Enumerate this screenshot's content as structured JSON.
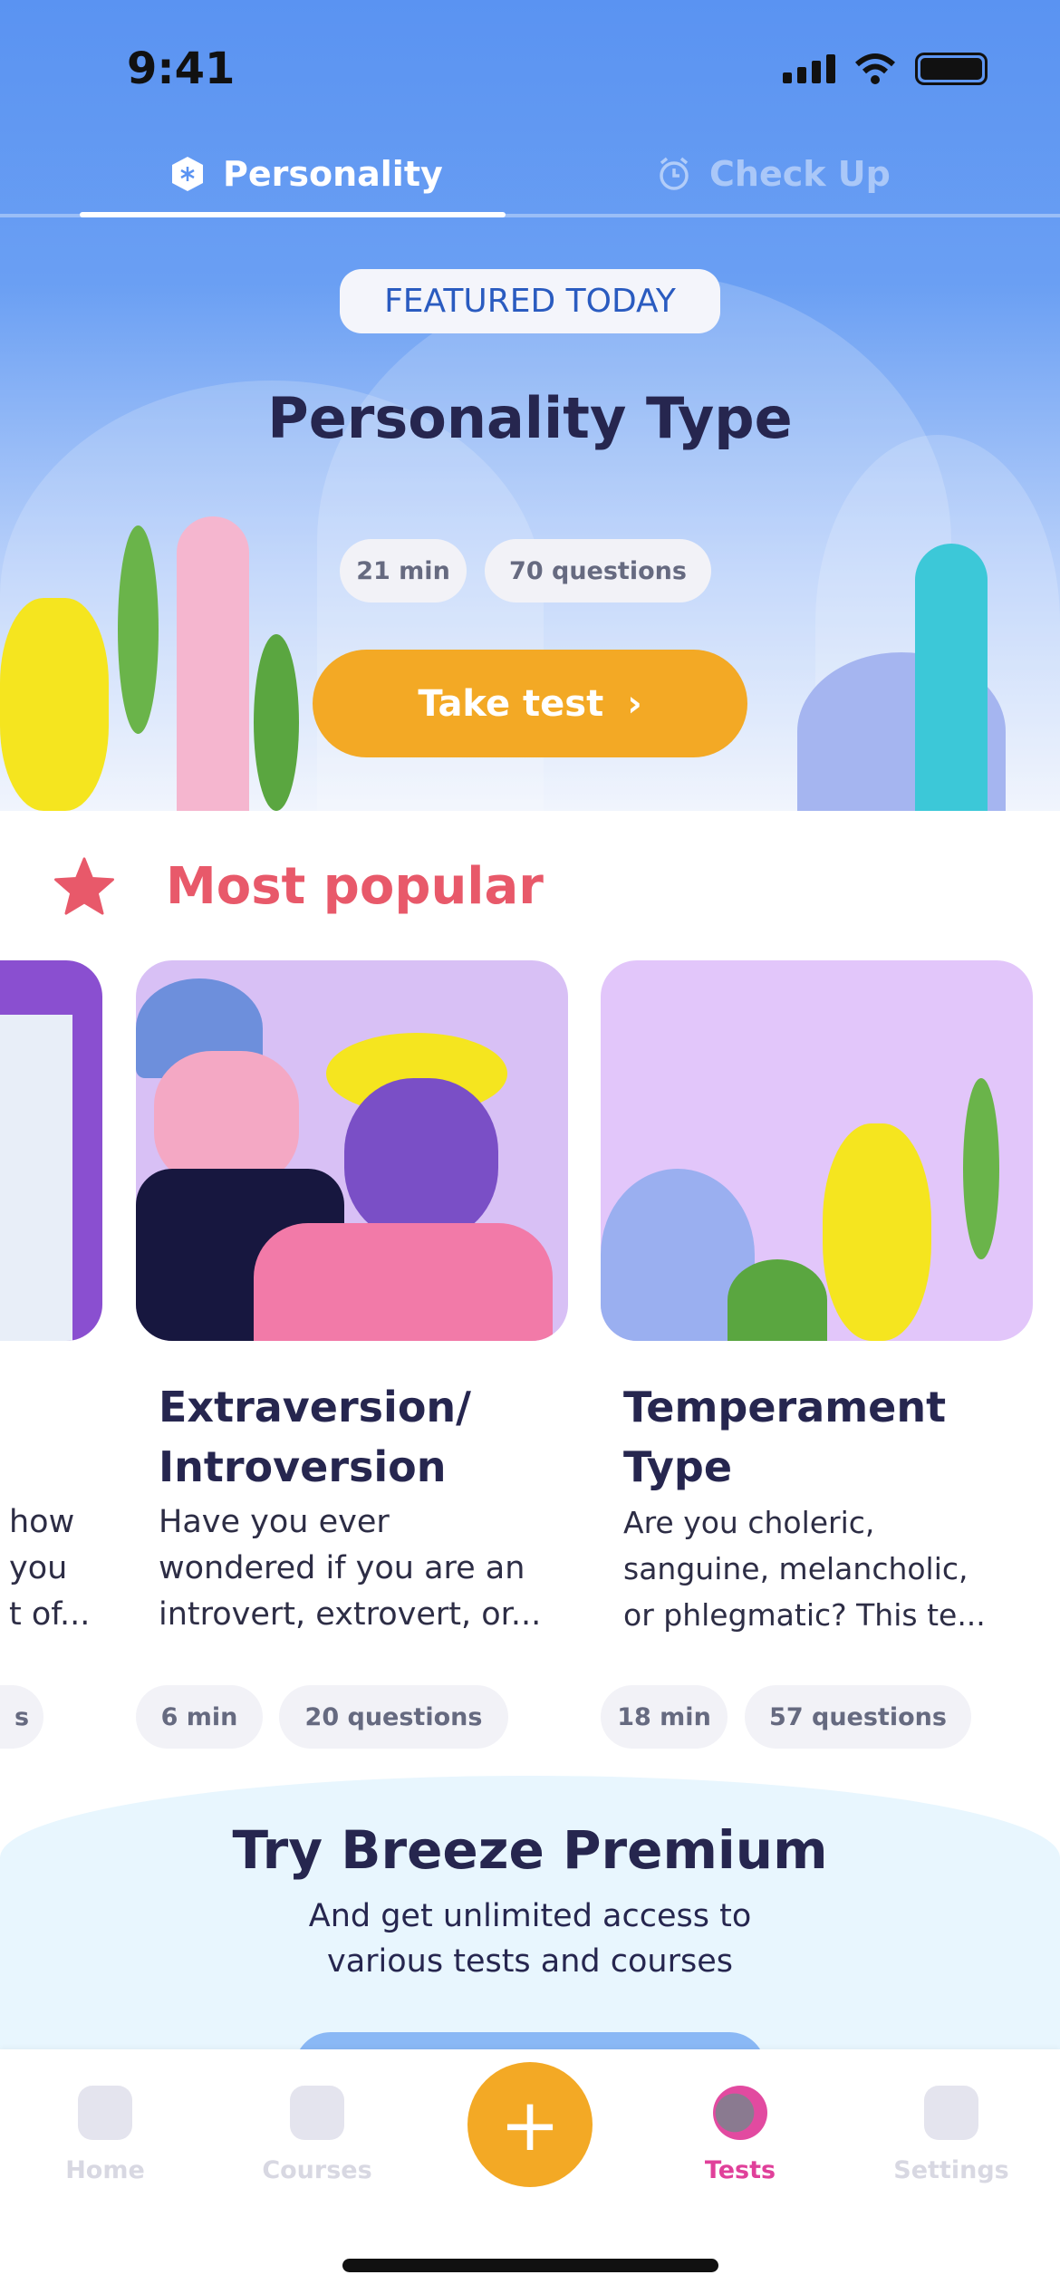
{
  "status": {
    "time": "9:41"
  },
  "top_tabs": [
    {
      "label": "Personality",
      "icon": "hexagon-star-icon",
      "active": true
    },
    {
      "label": "Check Up",
      "icon": "alarm-clock-icon",
      "active": false
    }
  ],
  "featured": {
    "badge": "FEATURED TODAY",
    "title": "Personality Type",
    "duration": "21 min",
    "questions": "70 questions",
    "cta": "Take test",
    "cta_icon": "›"
  },
  "popular": {
    "heading": "Most popular",
    "icon": "star-icon",
    "cards": [
      {
        "title": "",
        "desc_lines": [
          "how",
          "you",
          "t of..."
        ],
        "duration": "",
        "questions": "s"
      },
      {
        "title_lines": [
          "Extraversion/",
          "Introversion"
        ],
        "desc_lines": [
          "Have you ever",
          "wondered if you are an",
          "introvert, extrovert, or..."
        ],
        "duration": "6 min",
        "questions": "20 questions"
      },
      {
        "title_lines": [
          "Temperament",
          "Type"
        ],
        "desc_lines": [
          "Are you choleric,",
          "sanguine, melancholic,",
          "or phlegmatic? This te..."
        ],
        "duration": "18 min",
        "questions": "57 questions"
      }
    ]
  },
  "premium": {
    "title": "Try Breeze Premium",
    "subtitle_lines": [
      "And get unlimited access to",
      "various tests and courses"
    ]
  },
  "bottom_nav": [
    {
      "label": "Home"
    },
    {
      "label": "Courses"
    },
    {
      "label": "+"
    },
    {
      "label": "Tests",
      "active": true
    },
    {
      "label": "Settings"
    }
  ],
  "colors": {
    "primary": "#5a93f2",
    "accent": "#f3a925",
    "popular": "#e8596a",
    "active_tab": "#e0409a"
  }
}
